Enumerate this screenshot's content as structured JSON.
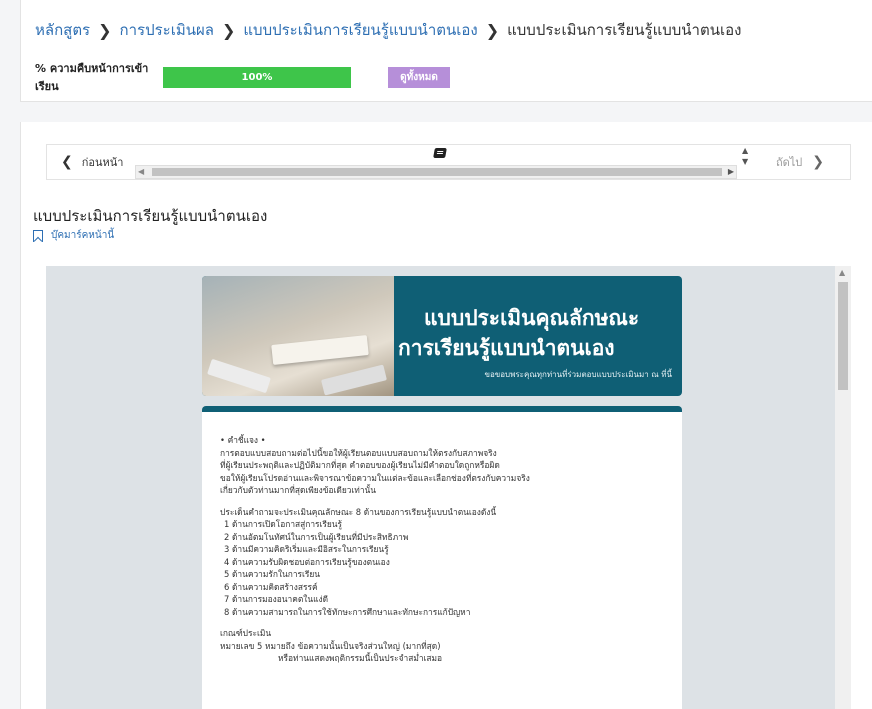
{
  "breadcrumb": {
    "items": [
      "หลักสูตร",
      "การประเมินผล",
      "แบบประเมินการเรียนรู้แบบนำตนเอง",
      "แบบประเมินการเรียนรู้แบบนำตนเอง"
    ],
    "separator": "❯"
  },
  "progress": {
    "label": "% ความคืบหน้าการเข้าเรียน",
    "percent": 100,
    "text": "100%",
    "fill_color": "#3ec54a"
  },
  "view_all_label": "ดูทั้งหมด",
  "nav": {
    "prev_label": "ก่อนหน้า",
    "next_label": "ถัดไป",
    "prev_icon": "chevron-left-icon",
    "next_icon": "chevron-right-icon"
  },
  "page_title": "แบบประเมินการเรียนรู้แบบนำตนเอง",
  "bookmark_label": "บุ๊คมาร์คหน้านี้",
  "form": {
    "header_title_line1": "แบบประเมินคุณลักษณะ",
    "header_title_line2": "การเรียนรู้แบบนำตนเอง",
    "header_subtitle": "ขอขอบพระคุณทุกท่านที่ร่วมตอบแบบประเมินมา ณ ที่นี้",
    "accent_color": "#0f5f75",
    "intro_heading": "• คำชี้แจง •",
    "intro_lines": [
      "การตอบแบบสอบถามต่อไปนี้ขอให้ผู้เรียนตอบแบบสอบถามให้ตรงกับสภาพจริง",
      "ที่ผู้เรียนประพฤติและปฏิบัติมากที่สุด คำตอบของผู้เรียนไม่มีคำตอบใดถูกหรือผิด",
      "ขอให้ผู้เรียนโปรดอ่านและพิจารณาข้อความในแต่ละข้อและเลือกช่องที่ตรงกับความจริง",
      "เกี่ยวกับตัวท่านมากที่สุดเพียงข้อเดียวเท่านั้น"
    ],
    "aspects_heading": "ประเด็นคำถามจะประเมินคุณลักษณะ 8 ด้านของการเรียนรู้แบบนำตนเองดังนี้",
    "aspects": [
      "1 ด้านการเปิดโอกาสสู่การเรียนรู้",
      "2 ด้านอัตมโนทัศน์ในการเป็นผู้เรียนที่มีประสิทธิภาพ",
      "3 ด้านมีความคิดริเริ่มและมีอิสระในการเรียนรู้",
      "4 ด้านความรับผิดชอบต่อการเรียนรู้ของตนเอง",
      "5 ด้านความรักในการเรียน",
      "6 ด้านความคิดสร้างสรรค์",
      "7 ด้านการมองอนาคตในแง่ดี",
      "8 ด้านความสามารถในการใช้ทักษะการศึกษาและทักษะการแก้ปัญหา"
    ],
    "criteria_heading": "เกณฑ์ประเมิน",
    "criteria_line1": "หมายเลข 5 หมายถึง ข้อความนั้นเป็นจริงส่วนใหญ่ (มากที่สุด)",
    "criteria_line2": "หรือท่านแสดงพฤติกรรมนี้เป็นประจำสม่ำเสมอ"
  }
}
